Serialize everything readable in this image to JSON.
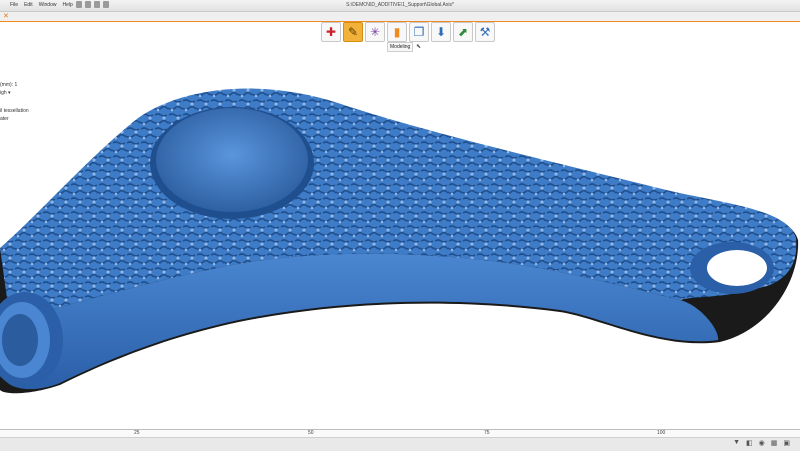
{
  "window": {
    "title": "S:\\DEMO\\6D_ADDITIVE\\1_Support\\Global.Axis*"
  },
  "menu": {
    "items": [
      "File",
      "Edit",
      "Window",
      "Help"
    ]
  },
  "toolbar": {
    "buttons": [
      {
        "icon": "add-icon",
        "glyph": "✚",
        "color": "#c8242b",
        "active": false
      },
      {
        "icon": "modeling-icon",
        "glyph": "✎",
        "color": "#5a3a00",
        "active": true
      },
      {
        "icon": "star-icon",
        "glyph": "✳",
        "color": "#7a3fa0",
        "active": false
      },
      {
        "icon": "signal-bars-icon",
        "glyph": "▮",
        "color": "#f08a1e",
        "active": false
      },
      {
        "icon": "copy-icon",
        "glyph": "❐",
        "color": "#2d6db5",
        "active": false
      },
      {
        "icon": "download-icon",
        "glyph": "⬇",
        "color": "#2d6db5",
        "active": false
      },
      {
        "icon": "export-icon",
        "glyph": "⬈",
        "color": "#2e8b3d",
        "active": false
      },
      {
        "icon": "tools-icon",
        "glyph": "⚒",
        "color": "#2d6db5",
        "active": false
      }
    ],
    "tooltip": "Modeling"
  },
  "sidepanel": {
    "lines": [
      "",
      "(mm): 1",
      "igh ▾",
      "il tessellation",
      "ater"
    ]
  },
  "ruler": {
    "ticks": [
      "25",
      "50",
      "75",
      "100"
    ]
  },
  "status": {
    "icons": [
      "filter-icon",
      "view-icon",
      "eye-icon",
      "grid-icon",
      "cube-icon"
    ]
  },
  "colors": {
    "model": "#3f7cc7",
    "accent": "#f08a1e"
  }
}
